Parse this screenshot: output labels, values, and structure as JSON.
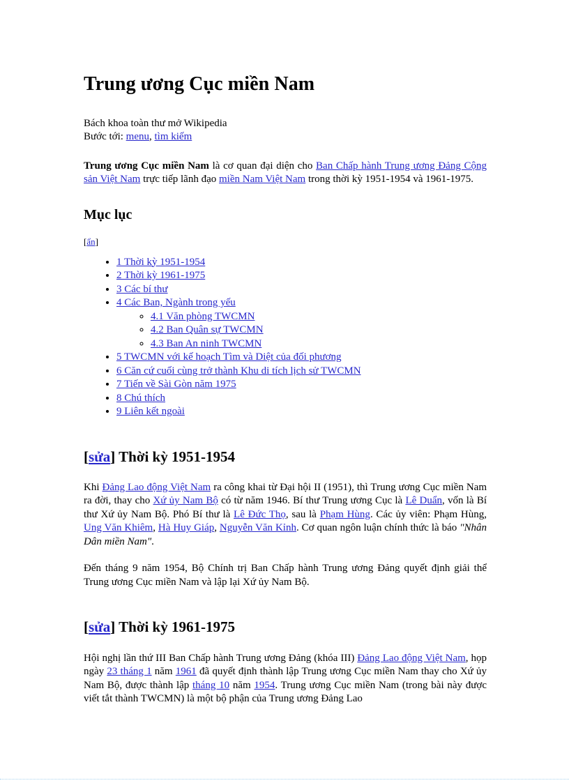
{
  "article": {
    "title": "Trung ương Cục miền Nam",
    "tagline": "Bách khoa toàn thư mở Wikipedia",
    "jump_label": "Bước tới:",
    "jump_menu": "menu",
    "jump_sep": ",",
    "jump_search": "tìm kiếm",
    "lead": {
      "bold_term": "Trung ương Cục miền Nam",
      "t1": " là cơ quan đại diện cho ",
      "link1": "Ban Chấp hành Trung ương Đảng Cộng sản Việt Nam",
      "t2": " trực tiếp lãnh đạo ",
      "link2": "miền Nam Việt Nam",
      "t3": " trong thời kỳ 1951-1954 và 1961-1975."
    }
  },
  "toc": {
    "heading": "Mục lục",
    "hide_open": "[",
    "hide_label": "ẩn",
    "hide_close": "]",
    "items": [
      {
        "label": "1 Thời kỳ 1951-1954"
      },
      {
        "label": "2 Thời kỳ 1961-1975"
      },
      {
        "label": "3 Các bí thư"
      },
      {
        "label": "4 Các Ban, Ngành trong yếu",
        "children": [
          {
            "label": "4.1 Văn phòng TWCMN"
          },
          {
            "label": "4.2 Ban Quân sự TWCMN"
          },
          {
            "label": "4.3 Ban An ninh TWCMN"
          }
        ]
      },
      {
        "label": "5 TWCMN với kế hoạch Tìm và Diệt của đối phương"
      },
      {
        "label": "6 Căn cứ cuối cùng trở thành Khu di tích lịch sử TWCMN"
      },
      {
        "label": "7 Tiến về Sài Gòn năm 1975"
      },
      {
        "label": "8 Chú thích"
      },
      {
        "label": "9 Liên kết ngoài"
      }
    ]
  },
  "sections": [
    {
      "edit_open": "[",
      "edit_label": "sửa",
      "edit_close": "]",
      "title": "Thời kỳ 1951-1954",
      "p1": {
        "t1": "Khi ",
        "l1": "Đảng Lao động Việt Nam",
        "t2": " ra công khai từ Đại hội II (1951), thì Trung ương Cục miền Nam ra đời, thay cho ",
        "l2": "Xứ ủy Nam Bộ",
        "t3": " có từ năm 1946. Bí thư Trung ương Cục là ",
        "l3": "Lê Duẩn",
        "t4": ", vốn là Bí thư Xứ ủy Nam Bộ. Phó Bí thư là ",
        "l4": "Lê Đức Thọ",
        "t5": ", sau là ",
        "l5": "Phạm Hùng",
        "t6": ". Các ủy viên: Phạm Hùng, ",
        "l6": "Ung Văn Khiêm",
        "t7": ", ",
        "l7": "Hà Huy Giáp",
        "t8": ", ",
        "l8": "Nguyễn Văn Kỉnh",
        "t9": ". Cơ quan ngôn luận chính thức là báo ",
        "paper": "\"Nhân Dân miền Nam\"",
        "t10": "."
      },
      "p2": "Đến tháng 9 năm 1954, Bộ Chính trị Ban Chấp hành Trung ương Đảng quyết định giải thể Trung ương Cục miền Nam và lập lại Xứ ủy Nam Bộ."
    },
    {
      "edit_open": "[",
      "edit_label": "sửa",
      "edit_close": "]",
      "title": "Thời kỳ 1961-1975",
      "p1": {
        "t1": "Hội nghị lần thứ III Ban Chấp hành Trung ương Đảng (khóa III) ",
        "l1": "Đảng Lao động Việt Nam",
        "t2": ", họp ngày ",
        "l2": "23 tháng 1",
        "t3": " năm ",
        "l3": "1961",
        "t4": " đã quyết định thành lập Trung ương Cục miền Nam thay cho Xứ ủy Nam Bộ, được thành lập ",
        "l4": "tháng 10",
        "t5": " năm ",
        "l5": "1954",
        "t6": ". Trung ương Cục miền Nam (trong bài này được viết tắt thành TWCMN) là một bộ phận của Trung ương Đảng Lao"
      }
    }
  ],
  "colors": {
    "link": "#2828cc",
    "text": "#000000",
    "background": "#ffffff",
    "pagebreak": "#a9d3ef"
  }
}
